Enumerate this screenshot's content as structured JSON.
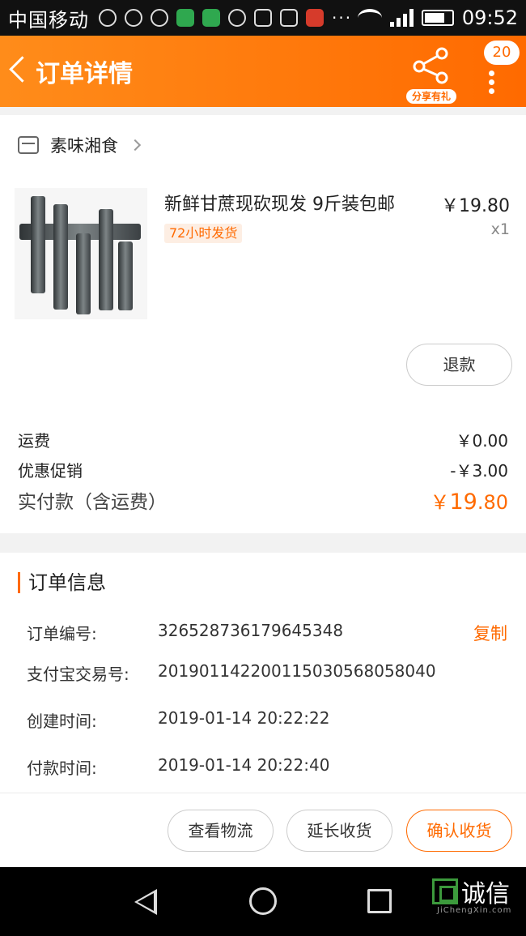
{
  "status_bar": {
    "carrier": "中国移动",
    "time": "09:52",
    "overflow": "···",
    "icons": [
      "shield-icon",
      "wifi-check-icon",
      "chat-bubble-icon",
      "taobao-app-icon",
      "taobao-app-icon",
      "wechat-icon",
      "lock-icon",
      "image-icon",
      "toutiao-app-icon"
    ]
  },
  "header": {
    "title": "订单详情",
    "share_label": "分享有礼",
    "badge_count": "20"
  },
  "shop": {
    "name": "素味湘食"
  },
  "product": {
    "title": "新鲜甘蔗现砍现发 9斤装包邮",
    "tag": "72小时发货",
    "price": "￥19.80",
    "quantity": "x1",
    "refund_label": "退款"
  },
  "fees": {
    "shipping_label": "运费",
    "shipping_value": "￥0.00",
    "promo_label": "优惠促销",
    "promo_value": "-￥3.00",
    "paid_label": "实付款（含运费）",
    "paid_symbol": "￥",
    "paid_int": "19",
    "paid_dec": ".80"
  },
  "order_info": {
    "title": "订单信息",
    "copy_label": "复制",
    "rows": [
      {
        "label": "订单编号:",
        "value": "326528736179645348"
      },
      {
        "label": "支付宝交易号:",
        "value": "2019011422001150305680580​40"
      },
      {
        "label": "创建时间:",
        "value": "2019-01-14 20:22:22"
      },
      {
        "label": "付款时间:",
        "value": "2019-01-14 20:22:40"
      }
    ]
  },
  "actions": {
    "logistics": "查看物流",
    "extend": "延长收货",
    "confirm": "确认收货"
  },
  "watermark": {
    "text": "诚信",
    "sub": "JiChengXin.com"
  },
  "colors": {
    "accent": "#ff6a00",
    "header_start": "#ff8c1a",
    "header_end": "#ff6a00"
  }
}
